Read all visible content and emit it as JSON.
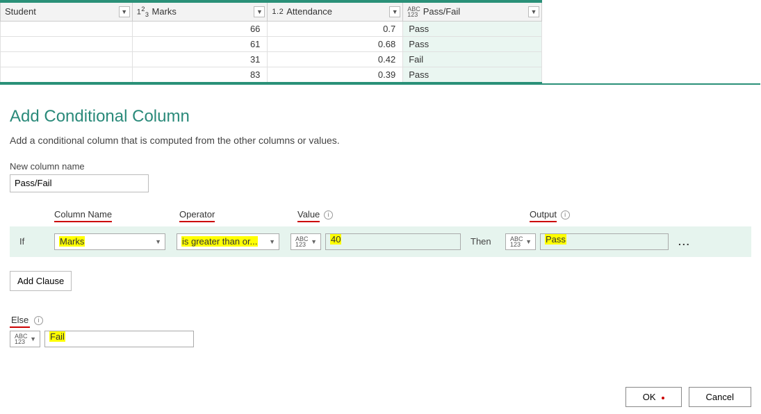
{
  "table": {
    "columns": [
      {
        "label": "Student",
        "type": ""
      },
      {
        "label": "Marks",
        "type": "123"
      },
      {
        "label": "Attendance",
        "type": "1.2"
      },
      {
        "label": "Pass/Fail",
        "type": "ABC123"
      }
    ],
    "rows": [
      {
        "student": "",
        "marks": "66",
        "attendance": "0.7",
        "result": "Pass"
      },
      {
        "student": "",
        "marks": "61",
        "attendance": "0.68",
        "result": "Pass"
      },
      {
        "student": "",
        "marks": "31",
        "attendance": "0.42",
        "result": "Fail"
      },
      {
        "student": "",
        "marks": "83",
        "attendance": "0.39",
        "result": "Pass"
      }
    ]
  },
  "dialog": {
    "title": "Add Conditional Column",
    "subtitle": "Add a conditional column that is computed from the other columns or values.",
    "new_col_label": "New column name",
    "new_col_value": "Pass/Fail",
    "headers": {
      "column_name": "Column Name",
      "operator": "Operator",
      "value": "Value",
      "output": "Output"
    },
    "if_label": "If",
    "then_label": "Then",
    "rule": {
      "column": "Marks",
      "operator": "is greater than or...",
      "value_type": "ABC\n123",
      "value": "40",
      "output_type": "ABC\n123",
      "output": "Pass"
    },
    "add_clause": "Add Clause",
    "else_label": "Else",
    "else_type": "ABC\n123",
    "else_value": "Fail",
    "ok": "OK",
    "cancel": "Cancel"
  }
}
